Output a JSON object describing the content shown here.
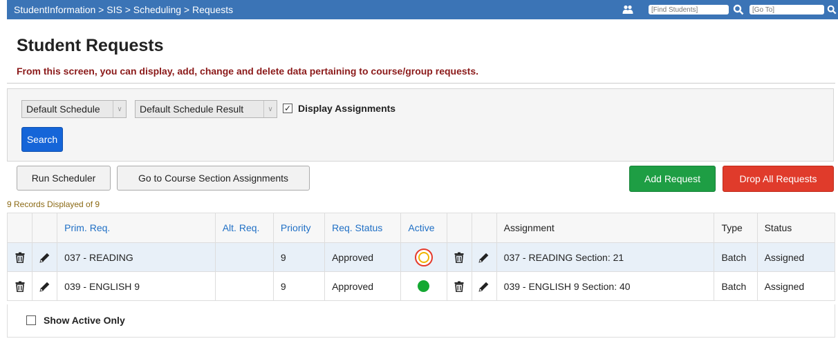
{
  "colors": {
    "topbar": "#3b74b6",
    "primary": "#1565d8",
    "add": "#1e9e44",
    "drop": "#e03b2b",
    "subtitle": "#8b1a1a",
    "active": "#14a832"
  },
  "topbar": {
    "breadcrumb": "StudentInformation > SIS > Scheduling > Requests",
    "find_placeholder": "[Find Students]",
    "goto_placeholder": "[Go To]"
  },
  "page": {
    "title": "Student Requests",
    "subtitle": "From this screen, you can display, add, change and delete data pertaining to course/group requests."
  },
  "filters": {
    "schedule_select": "Default Schedule",
    "result_select": "Default Schedule Result",
    "display_assignments_label": "Display Assignments",
    "display_assignments_checked": true,
    "search_label": "Search"
  },
  "actions": {
    "run_scheduler": "Run Scheduler",
    "go_to_assignments": "Go to Course Section Assignments",
    "add_request": "Add Request",
    "drop_all": "Drop All Requests"
  },
  "records_text": "9 Records Displayed of 9",
  "table": {
    "headers": {
      "prim_req": "Prim. Req.",
      "alt_req": "Alt. Req.",
      "priority": "Priority",
      "req_status": "Req. Status",
      "active": "Active",
      "assignment": "Assignment",
      "type": "Type",
      "status": "Status"
    },
    "rows": [
      {
        "prim_req": "037 - READING",
        "alt_req": "",
        "priority": "9",
        "req_status": "Approved",
        "active": "inactive-highlighted",
        "assignment": "037 - READING Section: 21",
        "type": "Batch",
        "status": "Assigned"
      },
      {
        "prim_req": "039 - ENGLISH 9",
        "alt_req": "",
        "priority": "9",
        "req_status": "Approved",
        "active": "active",
        "assignment": "039 - ENGLISH 9 Section: 40",
        "type": "Batch",
        "status": "Assigned"
      }
    ]
  },
  "footer": {
    "show_active_only_label": "Show Active Only",
    "show_active_only_checked": false
  }
}
